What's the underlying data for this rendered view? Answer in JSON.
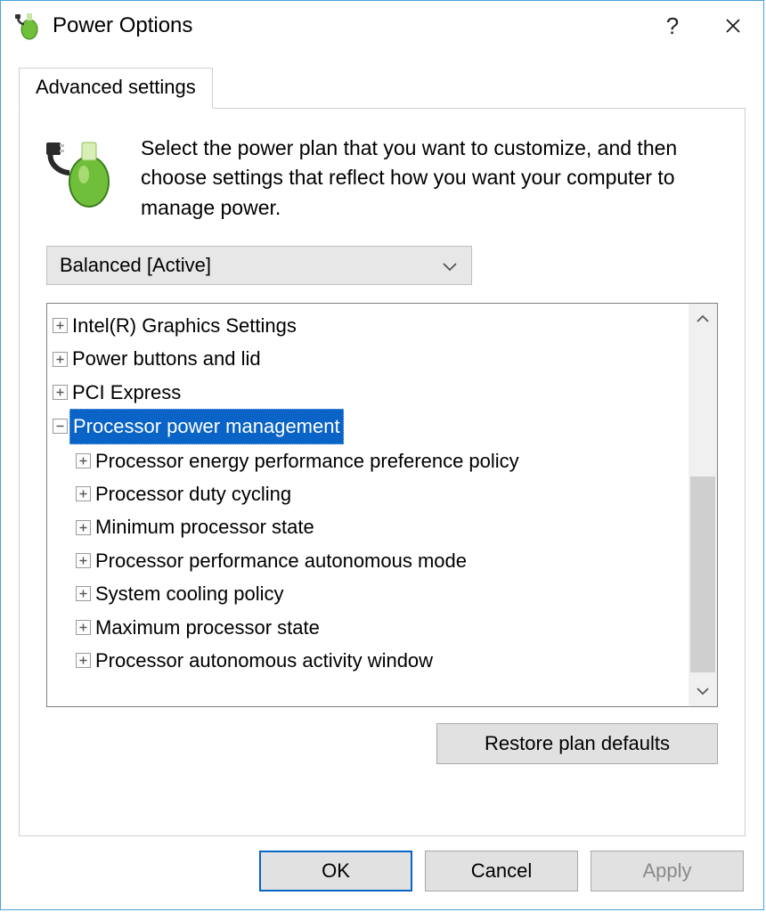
{
  "window": {
    "title": "Power Options",
    "help_symbol": "?",
    "close_symbol": "✕"
  },
  "tab": {
    "label": "Advanced settings"
  },
  "intro": "Select the power plan that you want to customize, and then choose settings that reflect how you want your computer to manage power.",
  "plan_selector": {
    "selected": "Balanced [Active]"
  },
  "tree": {
    "items": [
      {
        "label": "Intel(R) Graphics Settings",
        "level": 0,
        "expanded": false,
        "selected": false
      },
      {
        "label": "Power buttons and lid",
        "level": 0,
        "expanded": false,
        "selected": false
      },
      {
        "label": "PCI Express",
        "level": 0,
        "expanded": false,
        "selected": false
      },
      {
        "label": "Processor power management",
        "level": 0,
        "expanded": true,
        "selected": true
      },
      {
        "label": "Processor energy performance preference policy",
        "level": 1,
        "expanded": false,
        "selected": false
      },
      {
        "label": "Processor duty cycling",
        "level": 1,
        "expanded": false,
        "selected": false
      },
      {
        "label": "Minimum processor state",
        "level": 1,
        "expanded": false,
        "selected": false
      },
      {
        "label": "Processor performance autonomous mode",
        "level": 1,
        "expanded": false,
        "selected": false
      },
      {
        "label": "System cooling policy",
        "level": 1,
        "expanded": false,
        "selected": false
      },
      {
        "label": "Maximum processor state",
        "level": 1,
        "expanded": false,
        "selected": false
      },
      {
        "label": "Processor autonomous activity window",
        "level": 1,
        "expanded": false,
        "selected": false
      }
    ]
  },
  "buttons": {
    "restore": "Restore plan defaults",
    "ok": "OK",
    "cancel": "Cancel",
    "apply": "Apply"
  }
}
